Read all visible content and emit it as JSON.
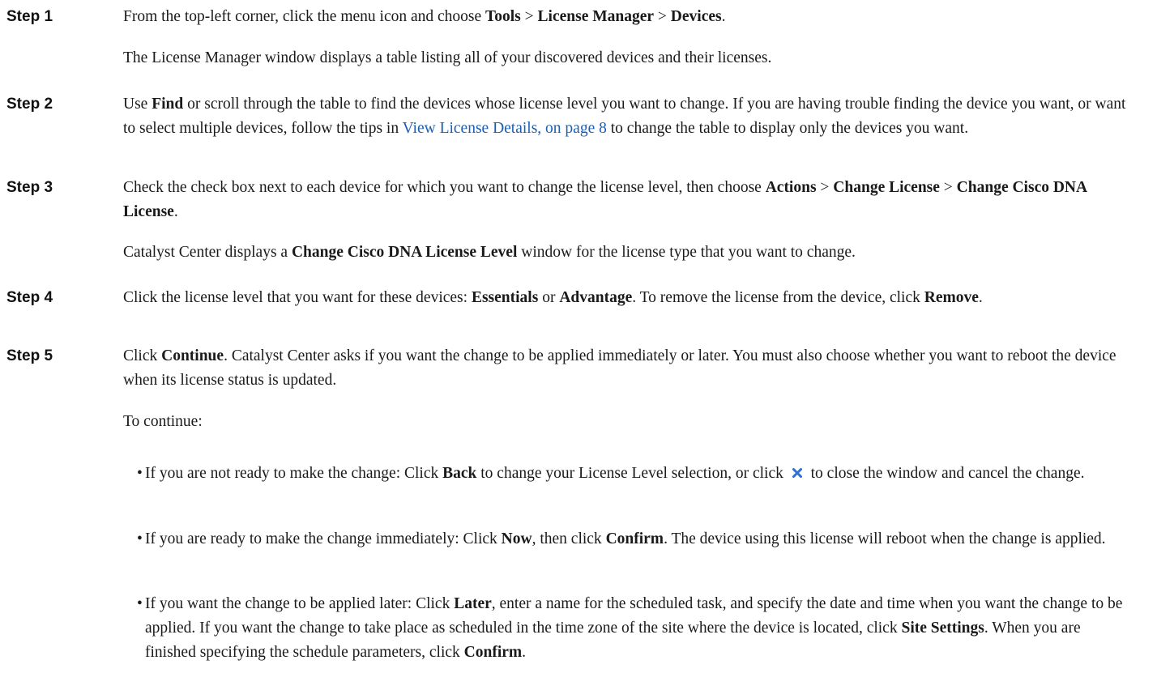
{
  "steps": [
    {
      "label": "Step 1",
      "p1": {
        "t1": "From the top-left corner, click the menu icon and choose ",
        "b1": "Tools",
        "t2": " > ",
        "b2": "License Manager",
        "t3": " > ",
        "b3": "Devices",
        "t4": "."
      },
      "p2": "The License Manager window displays a table listing all of your discovered devices and their licenses."
    },
    {
      "label": "Step 2",
      "p1": {
        "t1": "Use ",
        "b1": "Find",
        "t2": " or scroll through the table to find the devices whose license level you want to change. If you are having trouble finding the device you want, or want to select multiple devices, follow the tips in ",
        "link": "View License Details, on page 8",
        "t3": " to change the table to display only the devices you want."
      }
    },
    {
      "label": "Step 3",
      "p1": {
        "t1": "Check the check box next to each device for which you want to change the license level, then choose ",
        "b1": "Actions",
        "t2": " > ",
        "b2": "Change License",
        "t3": " > ",
        "b3": "Change Cisco DNA License",
        "t4": "."
      },
      "p2": {
        "t1": "Catalyst Center displays a ",
        "b1": "Change Cisco DNA License Level",
        "t2": " window for the license type that you want to change."
      }
    },
    {
      "label": "Step 4",
      "p1": {
        "t1": "Click the license level that you want for these devices: ",
        "b1": "Essentials",
        "t2": " or ",
        "b2": "Advantage",
        "t3": ". To remove the license from the device, click ",
        "b3": "Remove",
        "t4": "."
      }
    },
    {
      "label": "Step 5",
      "p1": {
        "t1": "Click ",
        "b1": "Continue",
        "t2": ". Catalyst Center asks if you want the change to be applied immediately or later. You must also choose whether you want to reboot the device when its license status is updated."
      },
      "p2": "To continue:",
      "bullets": [
        {
          "t1": "If you are not ready to make the change: Click ",
          "b1": "Back",
          "t2": " to change your License Level selection, or click ",
          "t3": " to close the window and cancel the change."
        },
        {
          "t1": "If you are ready to make the change immediately: Click ",
          "b1": "Now",
          "t2": ", then click ",
          "b2": "Confirm",
          "t3": ". The device using this license will reboot when the change is applied."
        },
        {
          "t1": "If you want the change to be applied later: Click ",
          "b1": "Later",
          "t2": ", enter a name for the scheduled task, and specify the date and time when you want the change to be applied. If you want the change to take place as scheduled in the time zone of the site where the device is located, click ",
          "b2": "Site Settings",
          "t3": ". When you are finished specifying the schedule parameters, click ",
          "b3": "Confirm",
          "t4": "."
        }
      ]
    }
  ],
  "bullet_char": "•",
  "colors": {
    "link": "#1a5fb4",
    "close_icon": "#2f6fd0"
  },
  "icons": {
    "close": "close-x-icon"
  }
}
